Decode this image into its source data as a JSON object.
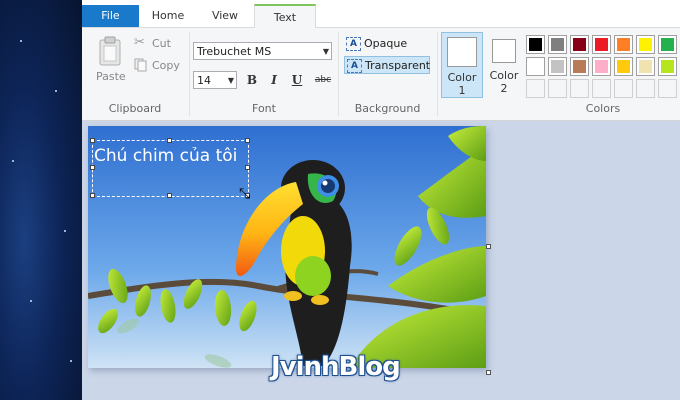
{
  "tabs": [
    {
      "label": "File"
    },
    {
      "label": "Home"
    },
    {
      "label": "View"
    },
    {
      "label": "Text"
    }
  ],
  "clipboard": {
    "paste_label": "Paste",
    "cut_label": "Cut",
    "copy_label": "Copy",
    "group_label": "Clipboard"
  },
  "font": {
    "family": "Trebuchet MS",
    "size": "14",
    "bold_label": "B",
    "italic_label": "I",
    "underline_label": "U",
    "strike_label": "abc",
    "group_label": "Font"
  },
  "background": {
    "opaque_label": "Opaque",
    "transparent_label": "Transparent",
    "selected": "Transparent",
    "group_label": "Background"
  },
  "colors": {
    "color1_label": "Color\n1",
    "color1_line1": "Color",
    "color1_line2": "1",
    "color2_line1": "Color",
    "color2_line2": "2",
    "group_label": "Colors",
    "palette_row1": [
      "#000000",
      "#7f7f7f",
      "#880015",
      "#ed1c24",
      "#ff7f27",
      "#fff200",
      "#22b14c"
    ],
    "palette_row2": [
      "#ffffff",
      "#c3c3c3",
      "#b97a57",
      "#ffaec9",
      "#ffc90e",
      "#efe4b0",
      "#b5e61d"
    ]
  },
  "canvas": {
    "text": "Chú chim của tôi"
  },
  "watermark": "JvinhBlog"
}
